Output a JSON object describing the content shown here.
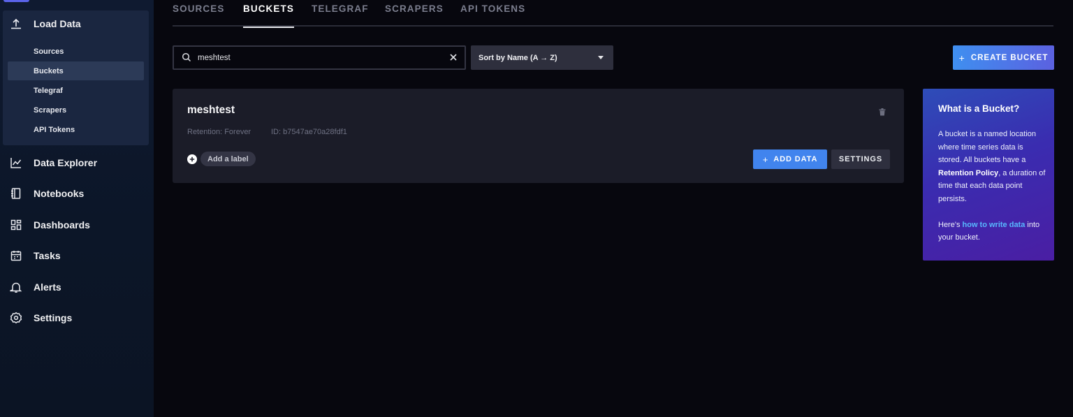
{
  "sidebar": {
    "load_data": {
      "label": "Load Data",
      "icon": "upload-icon",
      "subitems": [
        {
          "label": "Sources",
          "active": false
        },
        {
          "label": "Buckets",
          "active": true
        },
        {
          "label": "Telegraf",
          "active": false
        },
        {
          "label": "Scrapers",
          "active": false
        },
        {
          "label": "API Tokens",
          "active": false
        }
      ]
    },
    "items": [
      {
        "label": "Data Explorer",
        "icon": "chart-line-icon"
      },
      {
        "label": "Notebooks",
        "icon": "notebook-icon"
      },
      {
        "label": "Dashboards",
        "icon": "dashboard-icon"
      },
      {
        "label": "Tasks",
        "icon": "calendar-icon"
      },
      {
        "label": "Alerts",
        "icon": "bell-icon"
      },
      {
        "label": "Settings",
        "icon": "gear-icon"
      }
    ]
  },
  "tabs": [
    {
      "label": "SOURCES",
      "active": false
    },
    {
      "label": "BUCKETS",
      "active": true
    },
    {
      "label": "TELEGRAF",
      "active": false
    },
    {
      "label": "SCRAPERS",
      "active": false
    },
    {
      "label": "API TOKENS",
      "active": false
    }
  ],
  "search": {
    "value": "meshtest",
    "icon": "search-icon",
    "clear_icon": "close-icon"
  },
  "sort": {
    "label": "Sort by Name (A → Z)",
    "icon": "caret-down-icon"
  },
  "create_button": {
    "plus": "+",
    "label": "CREATE BUCKET"
  },
  "bucket": {
    "name": "meshtest",
    "retention": "Retention: Forever",
    "id": "ID: b7547ae70a28fdf1",
    "add_label": "Add a label",
    "add_data_plus": "+",
    "add_data": "ADD DATA",
    "settings": "SETTINGS",
    "delete_icon": "trash-icon"
  },
  "info": {
    "title": "What is a Bucket?",
    "p1_a": "A bucket is a named location where time series data is stored. All buckets have a ",
    "p1_b": "Retention Policy",
    "p1_c": ", a duration of time that each data point persists.",
    "p2_a": "Here's ",
    "p2_link": "how to write data",
    "p2_b": " into your bucket."
  },
  "colors": {
    "accent_blue": "#4184ee",
    "info_gradient_start": "#2e4db8",
    "info_gradient_end": "#4a1ea3",
    "link": "#58b8ff"
  }
}
